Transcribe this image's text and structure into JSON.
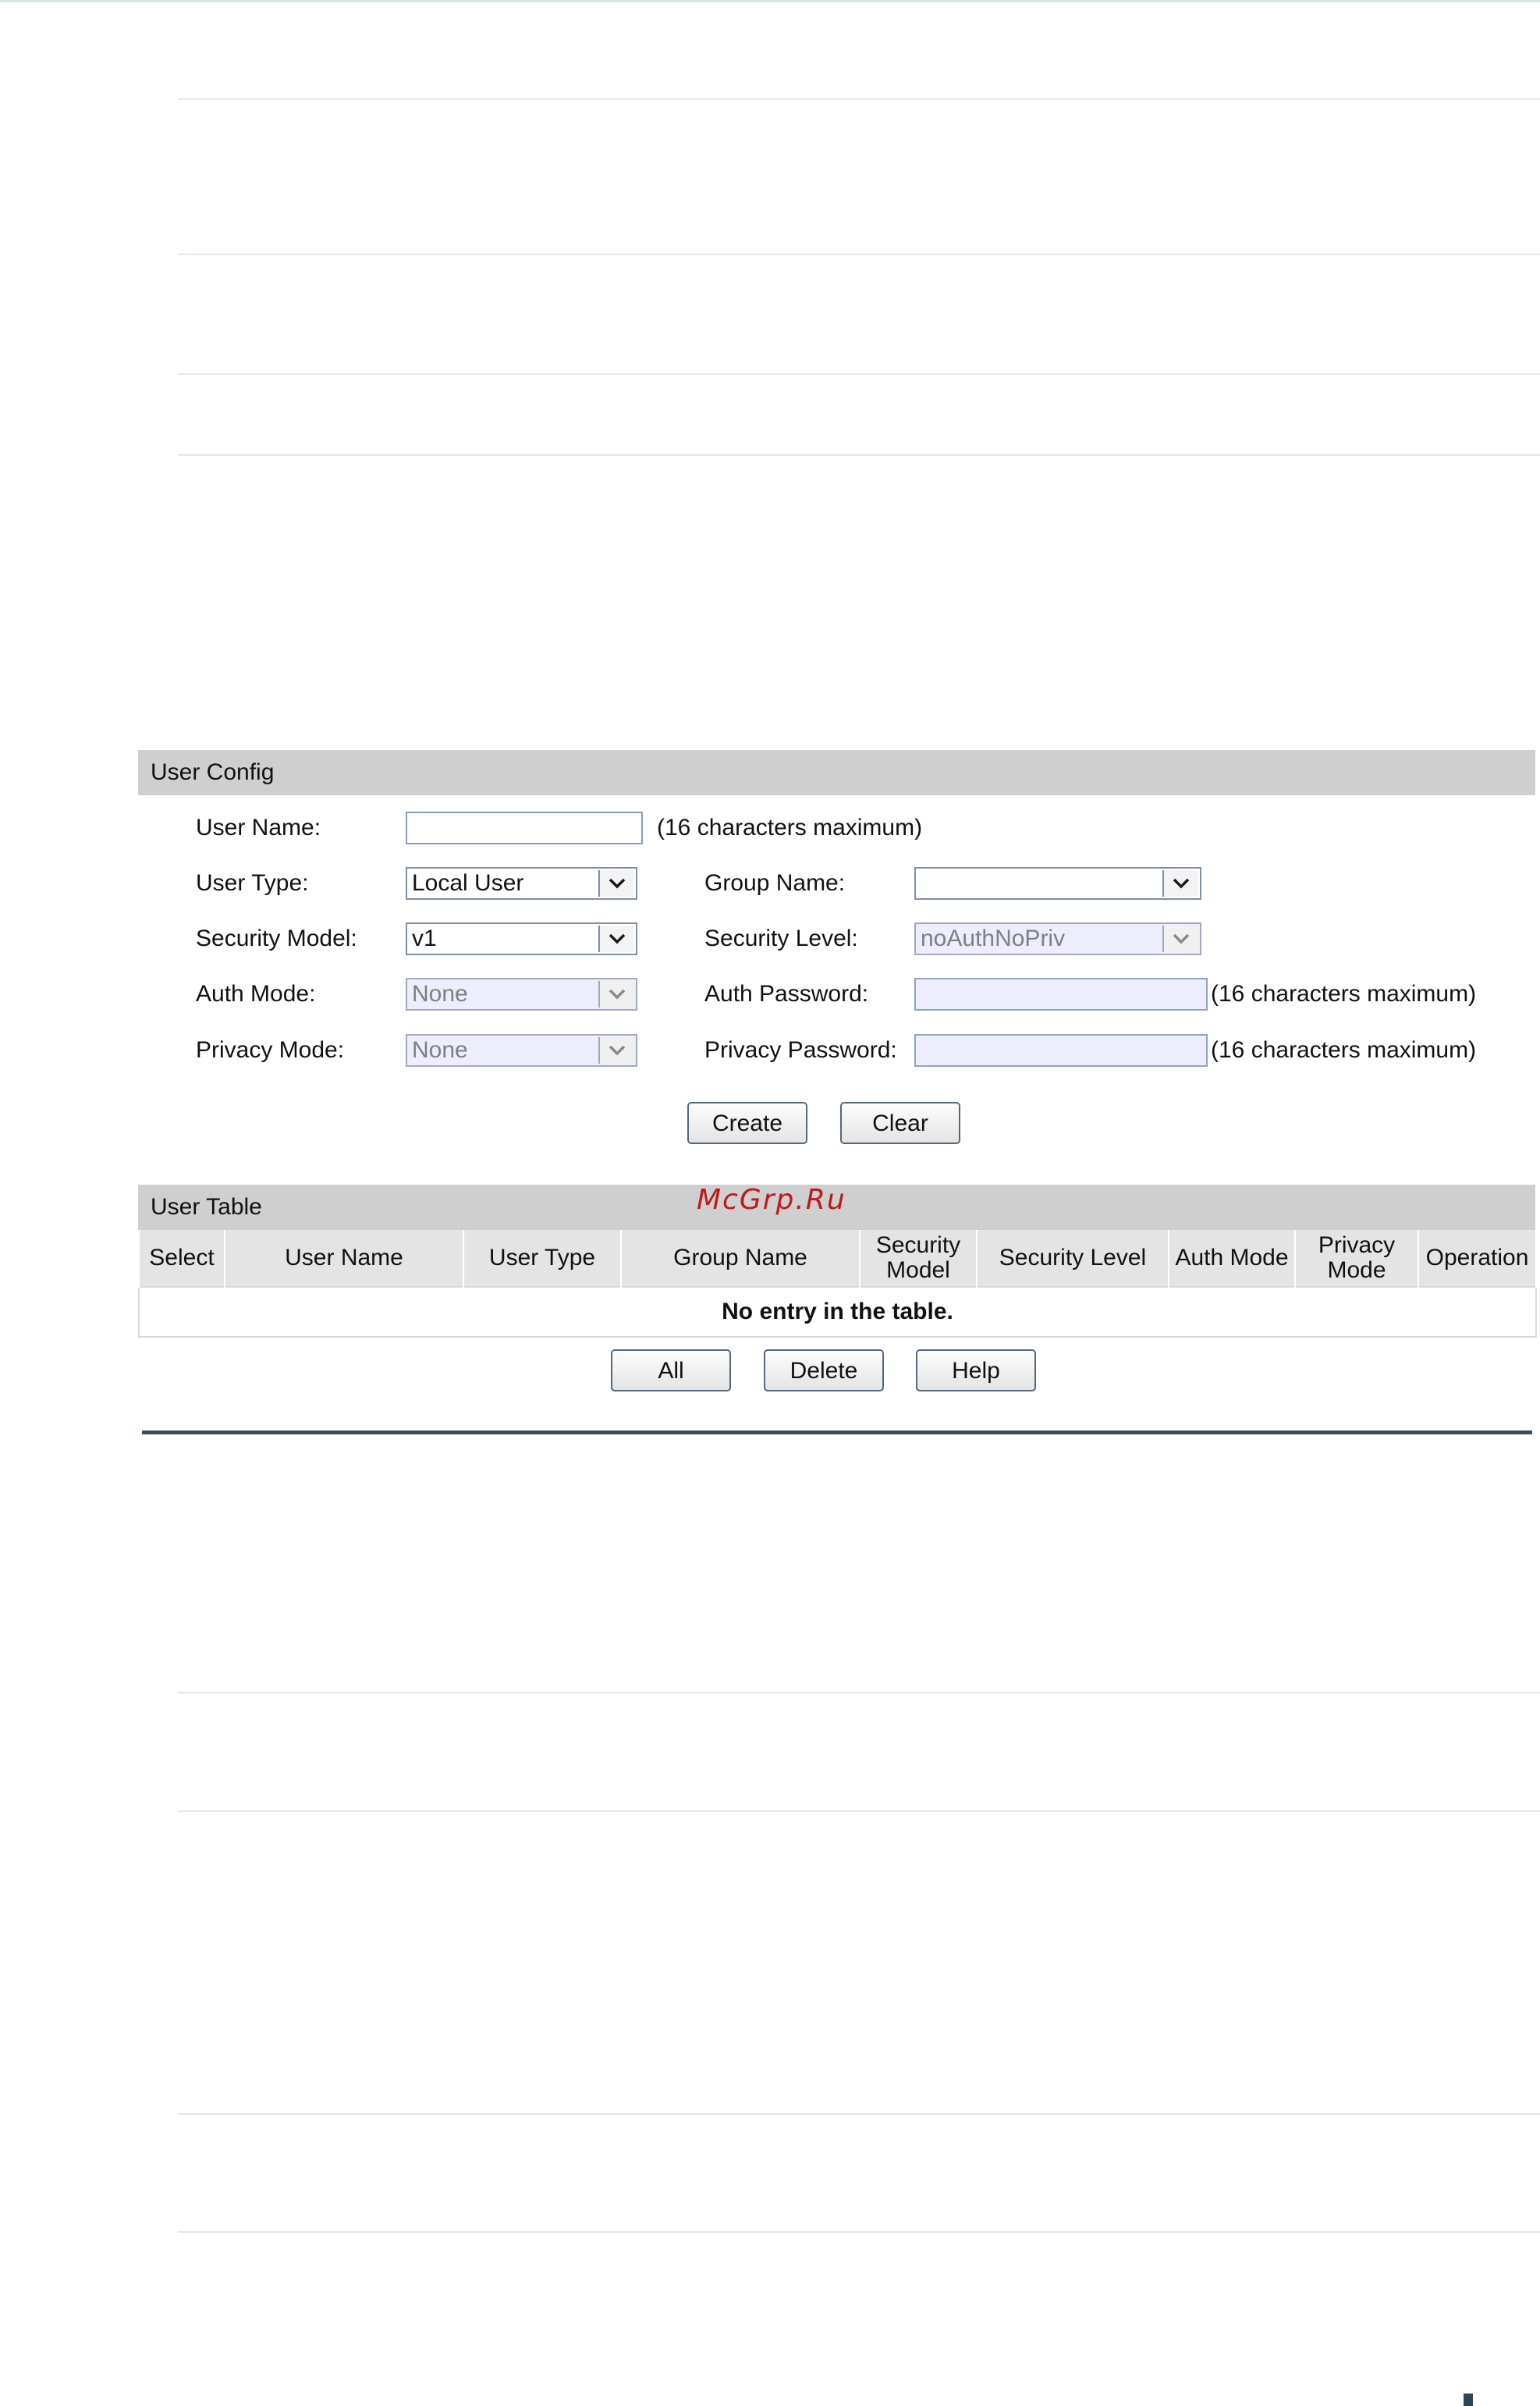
{
  "user_config": {
    "header": "User Config",
    "user_name_label": "User Name:",
    "user_name_value": "",
    "user_name_hint": "(16 characters maximum)",
    "user_type_label": "User Type:",
    "user_type_value": "Local User",
    "group_name_label": "Group Name:",
    "group_name_value": "",
    "security_model_label": "Security Model:",
    "security_model_value": "v1",
    "security_level_label": "Security Level:",
    "security_level_value": "noAuthNoPriv",
    "auth_mode_label": "Auth Mode:",
    "auth_mode_value": "None",
    "auth_password_label": "Auth Password:",
    "auth_password_hint": "(16 characters maximum)",
    "privacy_mode_label": "Privacy Mode:",
    "privacy_mode_value": "None",
    "privacy_password_label": "Privacy Password:",
    "privacy_password_hint": "(16 characters maximum)",
    "create_label": "Create",
    "clear_label": "Clear"
  },
  "user_table": {
    "header": "User Table",
    "columns": [
      "Select",
      "User Name",
      "User Type",
      "Group Name",
      "Security Model",
      "Security Level",
      "Auth Mode",
      "Privacy Mode",
      "Operation"
    ],
    "empty_text": "No entry in the table.",
    "all_label": "All",
    "delete_label": "Delete",
    "help_label": "Help"
  },
  "watermark": "McGrp.Ru",
  "icons": {
    "dropdown": "chevron-down-icon"
  },
  "colors": {
    "section_header_bg": "#cfcfcf",
    "disabled_field_bg": "#ededfb",
    "watermark": "#c0191a",
    "divider": "#3b4e5c"
  }
}
